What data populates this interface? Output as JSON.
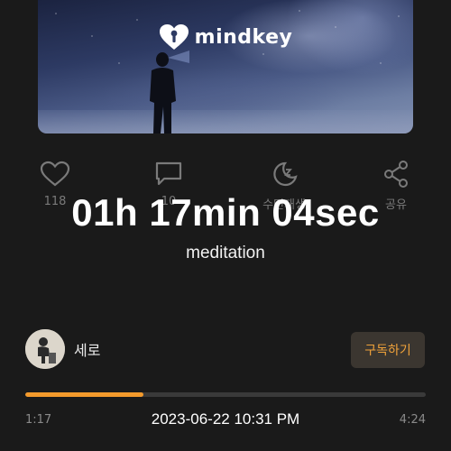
{
  "cover": {
    "brand_name": "mindkey",
    "brand_icon": "heart-keyhole-icon"
  },
  "actions": [
    {
      "name": "like",
      "icon": "heart-icon",
      "label": "118"
    },
    {
      "name": "comment",
      "icon": "chat-bubble-icon",
      "label": "10"
    },
    {
      "name": "sleep",
      "icon": "moon-zzz-icon",
      "label": "수면재생"
    },
    {
      "name": "share",
      "icon": "share-icon",
      "label": "공유"
    }
  ],
  "overlay": {
    "timer": "01h 17min 04sec",
    "subtitle": "meditation"
  },
  "author": {
    "name": "세로",
    "subscribe_label": "구독하기"
  },
  "player": {
    "current_time": "1:17",
    "total_time": "4:24",
    "progress": 0.295,
    "accent_color": "#f39a2c",
    "timestamp": "2023-06-22 10:31 PM"
  }
}
